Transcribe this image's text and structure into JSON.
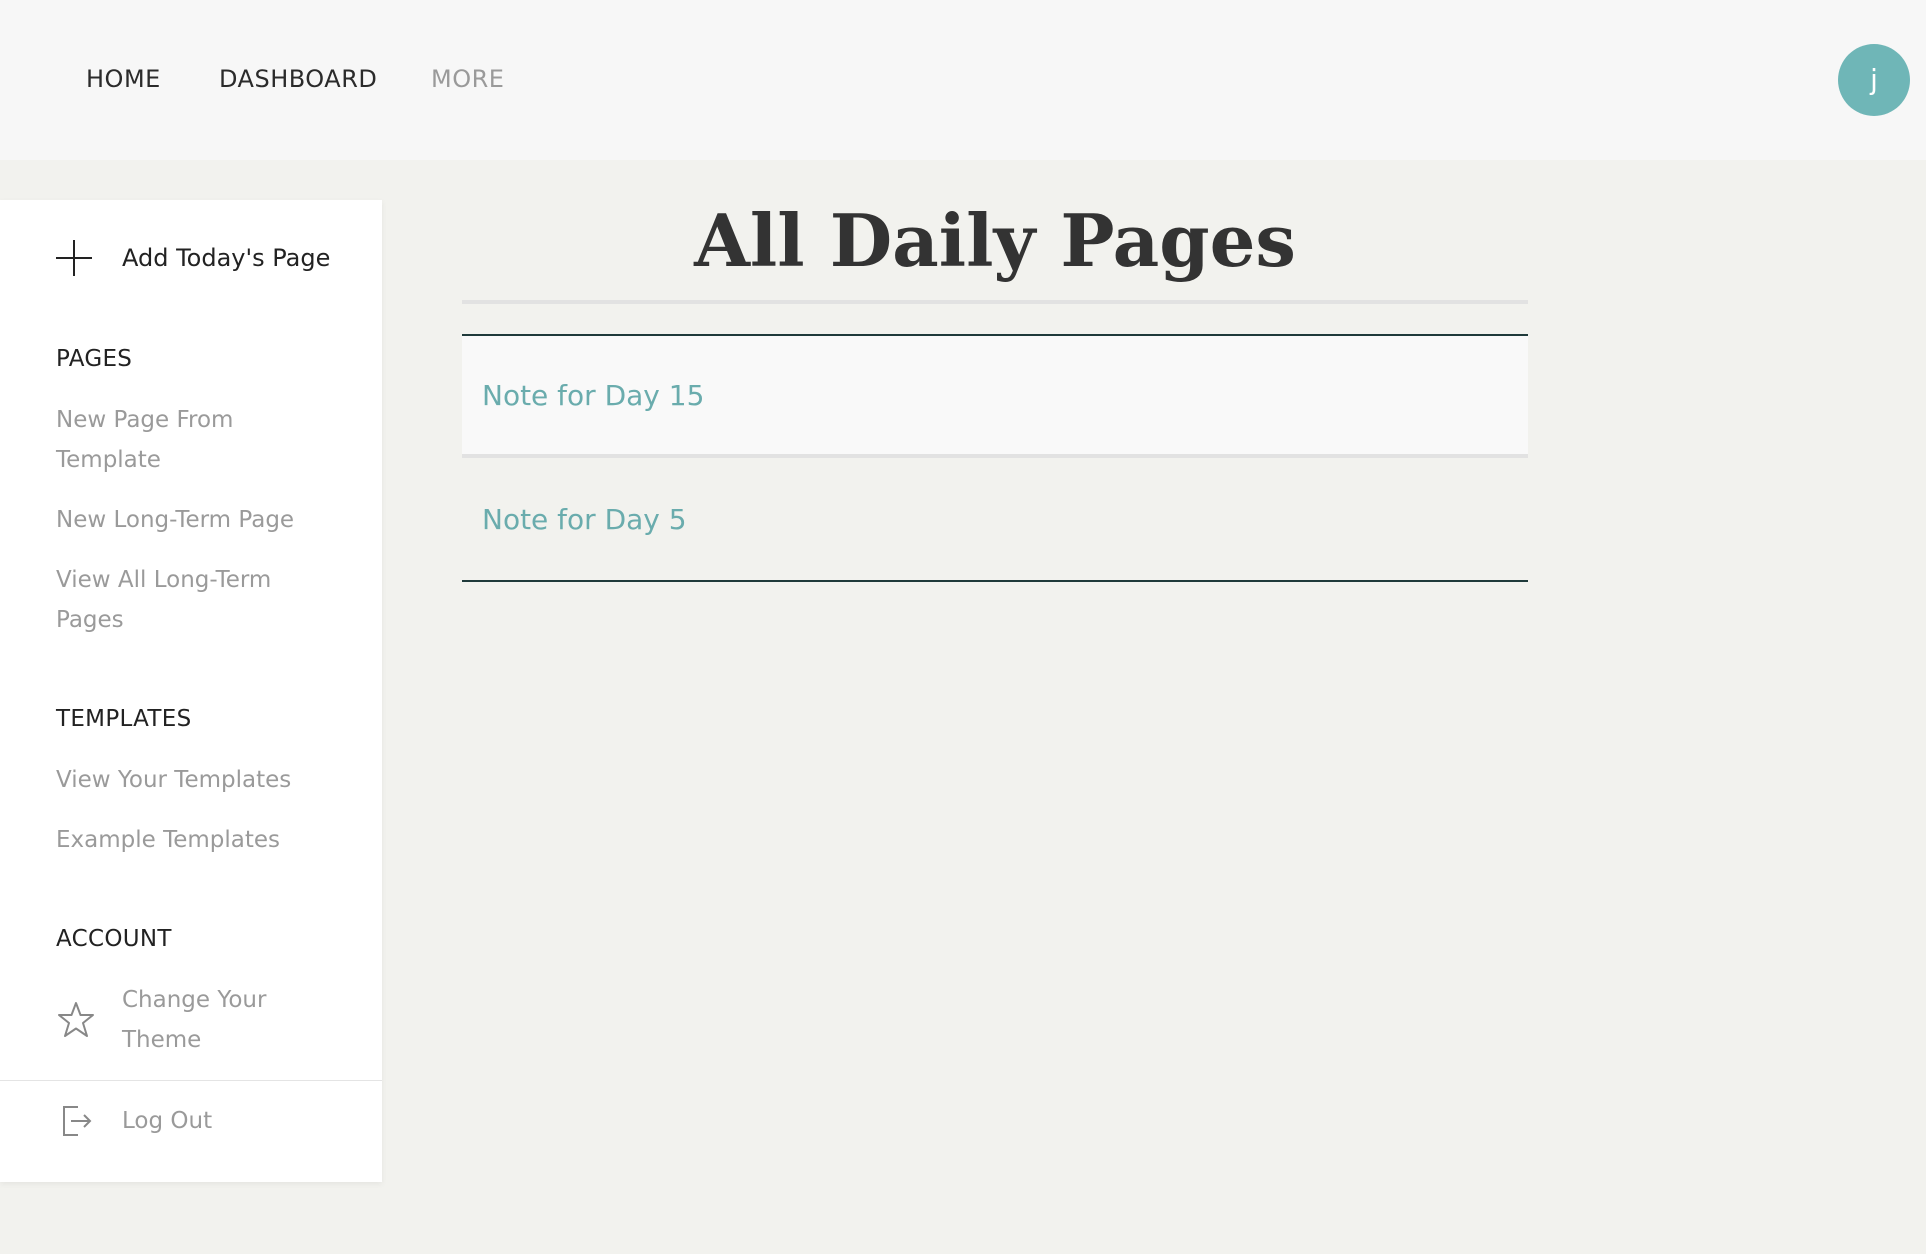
{
  "nav": {
    "home": "HOME",
    "dashboard": "DASHBOARD",
    "more": "MORE"
  },
  "user": {
    "avatar_initial": "j"
  },
  "sidebar": {
    "add_today": "Add Today's Page",
    "pages_heading": "PAGES",
    "pages_links": [
      "New Page From Template",
      "New Long-Term Page",
      "View All Long-Term Pages"
    ],
    "templates_heading": "TEMPLATES",
    "templates_links": [
      "View Your Templates",
      "Example Templates"
    ],
    "account_heading": "ACCOUNT",
    "change_theme": "Change Your Theme",
    "log_out": "Log Out"
  },
  "main": {
    "title": "All Daily Pages",
    "items": [
      "Note for Day 15",
      "Note for Day 5"
    ]
  },
  "colors": {
    "accent": "#6fb6b7",
    "link": "#6aacad",
    "background": "#f2f2ee"
  }
}
